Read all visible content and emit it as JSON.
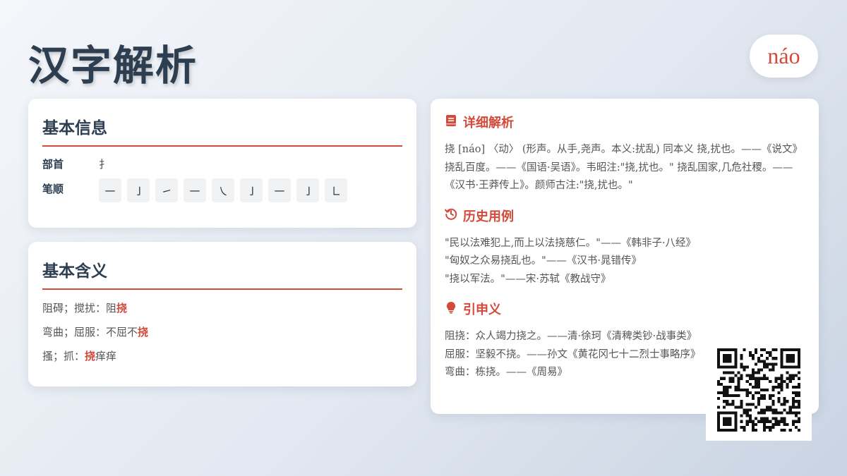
{
  "header": {
    "title": "汉字解析",
    "pinyin": "náo"
  },
  "basic_info": {
    "heading": "基本信息",
    "radical_label": "部首",
    "radical_value": "扌",
    "stroke_label": "笔顺",
    "strokes": [
      "㇐",
      "㇚",
      "㇀",
      "㇐",
      "㇏",
      "㇚",
      "㇐",
      "㇚",
      "㇗"
    ]
  },
  "basic_meaning": {
    "heading": "基本含义",
    "items": [
      {
        "prefix": "阻碍；搅扰：阻",
        "highlight": "挠",
        "suffix": ""
      },
      {
        "prefix": "弯曲；屈服：不屈不",
        "highlight": "挠",
        "suffix": ""
      },
      {
        "prefix": "搔；抓：",
        "highlight": "挠",
        "suffix": "痒痒"
      }
    ]
  },
  "detail": {
    "heading": "详细解析",
    "icon": "book-icon",
    "text": "挠 [náo] 〈动〉 (形声。从手,尧声。本义:扰乱) 同本义 挠,扰也。——《说文》 挠乱百度。——《国语·吴语》。韦昭注:\"挠,扰也。\" 挠乱国家,几危社稷。——《汉书·王莽传上》。颜师古注:\"挠,扰也。\""
  },
  "history": {
    "heading": "历史用例",
    "icon": "history-icon",
    "lines": [
      "\"民以法难犯上,而上以法挠慈仁。\"——《韩非子·八经》",
      "\"匈奴之众易挠乱也。\"——《汉书·晁错传》",
      "\"挠以军法。\"——宋·苏轼《教战守》"
    ]
  },
  "extended": {
    "heading": "引申义",
    "icon": "lightbulb-icon",
    "lines": [
      "阻挠：众人竭力挠之。——清·徐珂《清稗类钞·战事类》",
      "屈服：坚毅不挠。——孙文《黄花冈七十二烈士事略序》",
      "弯曲：栋挠。——《周易》"
    ]
  },
  "colors": {
    "accent": "#d44a3a",
    "text": "#2c3e50"
  }
}
